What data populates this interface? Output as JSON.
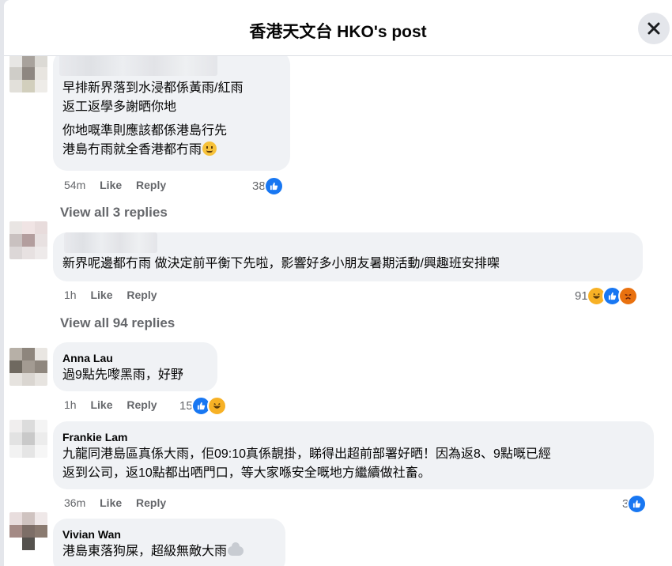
{
  "header": {
    "title": "香港天文台 HKO's post",
    "close_icon": "close-icon"
  },
  "comments": [
    {
      "name": "",
      "paragraphs": [
        "早排新界落到水浸都係黃雨/紅雨\n返工返學多謝晒你地",
        "你地嘅準則應該都係港島行先\n港島冇雨就全香港都冇雨"
      ],
      "time": "54m",
      "like": "Like",
      "reply": "Reply",
      "reaction_count": "38",
      "reactions": [
        "like-icon"
      ]
    },
    {
      "name": "",
      "paragraphs": [
        "新界呢邊都冇雨 做決定前平衡下先啦，影響好多小朋友暑期活動/興趣班安排㗎"
      ],
      "time": "1h",
      "like": "Like",
      "reply": "Reply",
      "reaction_count": "91",
      "reactions": [
        "haha-icon",
        "like-icon",
        "angry-icon"
      ]
    },
    {
      "name": "Anna Lau",
      "paragraphs": [
        "過9點先嚟黑雨，好野"
      ],
      "time": "1h",
      "like": "Like",
      "reply": "Reply",
      "reaction_count": "15",
      "reactions": [
        "like-icon",
        "haha-icon"
      ]
    },
    {
      "name": "Frankie Lam",
      "paragraphs": [
        "九龍同港島區真係大雨，佢09:10真係靚掛，睇得出超前部署好晒！因為返8、9點嘅已經\n返到公司，返10點都出哂門口，等大家喺安全嘅地方繼續做社畜。"
      ],
      "time": "36m",
      "like": "Like",
      "reply": "Reply",
      "reaction_count": "3",
      "reactions": [
        "like-icon"
      ]
    },
    {
      "name": "Vivian Wan",
      "paragraphs": [
        "港島東落狗屎，超級無敵大雨"
      ]
    }
  ],
  "view_replies": [
    "View all 3 replies",
    "View all 94 replies"
  ],
  "colors": {
    "like": "#1877f2",
    "bubble": "#f0f2f5",
    "meta": "#65676b"
  }
}
